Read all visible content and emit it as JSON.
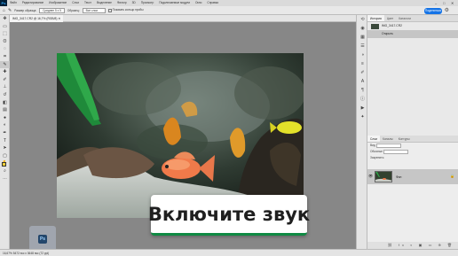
{
  "menubar": {
    "logo": "Ps",
    "items": [
      "Файл",
      "Редактирование",
      "Изображение",
      "Слои",
      "Текст",
      "Выделение",
      "Фильтр",
      "3D",
      "Просмотр",
      "Подключаемые модули",
      "Окно",
      "Справка"
    ]
  },
  "optbar": {
    "sample_label": "Размер образца:",
    "sample_value": "Среднее 5 x 5",
    "source_label": "Образец:",
    "source_value": "Все слои",
    "ring_label": "Показать кольцо пробы",
    "share_label": "Поделиться"
  },
  "document": {
    "tab_title": "IMG_3417.CR2 @ 16,7% (RGB/8)"
  },
  "overlay": {
    "text": "Включите звук"
  },
  "statusbar": {
    "text": "16,67%  5472 пкс x 3648 пкс (72 ppi)"
  },
  "panels": {
    "top_tabs": [
      "История",
      "Цвет",
      "Каталоги"
    ],
    "history": [
      {
        "label": "IMG_3417.CR2"
      },
      {
        "label": "Открыть"
      }
    ],
    "layer_tabs": [
      "Слои",
      "Каналы",
      "Контуры"
    ],
    "layer_rows": [
      "Вид",
      "Обычные",
      "Закрепить:"
    ],
    "layer": {
      "name": "Фон"
    }
  },
  "colors": {
    "foreground": "#f4d13a",
    "background": "#ffffff",
    "accent": "#1473e6",
    "overlay_border": "#0f8a43"
  },
  "icons": [
    "home-icon",
    "move-tool-icon",
    "marquee-tool-icon",
    "lasso-tool-icon",
    "eyedropper-tool-icon",
    "brush-tool-icon",
    "eye-icon",
    "lock-icon",
    "gear-icon"
  ]
}
